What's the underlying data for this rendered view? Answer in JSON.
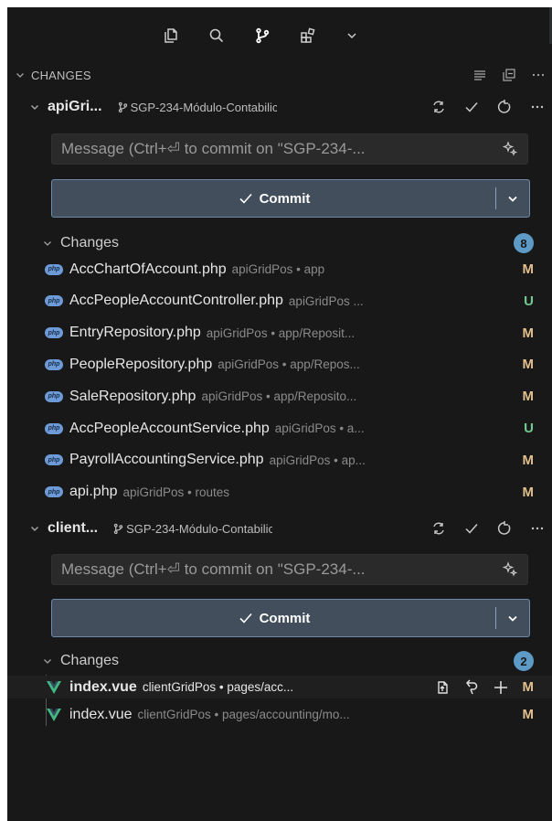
{
  "toolbar": {
    "icons": [
      "files-icon",
      "search-icon",
      "source-control-icon",
      "extensions-icon",
      "chevron-down-icon"
    ]
  },
  "section": {
    "title": "CHANGES",
    "actions": [
      "list-view-icon",
      "collapse-all-icon",
      "more-actions-icon"
    ]
  },
  "repos": [
    {
      "name": "apiGri...",
      "branch": "SGP-234-Módulo-Contabilic",
      "message_placeholder": "Message (Ctrl+⏎ to commit on \"SGP-234-...",
      "commit_label": "Commit",
      "group_label": "Changes",
      "count": "8",
      "files": [
        {
          "name": "AccChartOfAccount.php",
          "desc": "apiGridPos • app",
          "status": "M",
          "type": "php"
        },
        {
          "name": "AccPeopleAccountController.php",
          "desc": "apiGridPos ...",
          "status": "U",
          "type": "php"
        },
        {
          "name": "EntryRepository.php",
          "desc": "apiGridPos • app/Reposit...",
          "status": "M",
          "type": "php"
        },
        {
          "name": "PeopleRepository.php",
          "desc": "apiGridPos • app/Repos...",
          "status": "M",
          "type": "php"
        },
        {
          "name": "SaleRepository.php",
          "desc": "apiGridPos • app/Reposito...",
          "status": "M",
          "type": "php"
        },
        {
          "name": "AccPeopleAccountService.php",
          "desc": "apiGridPos • a...",
          "status": "U",
          "type": "php"
        },
        {
          "name": "PayrollAccountingService.php",
          "desc": "apiGridPos • ap...",
          "status": "M",
          "type": "php"
        },
        {
          "name": "api.php",
          "desc": "apiGridPos • routes",
          "status": "M",
          "type": "php"
        }
      ]
    },
    {
      "name": "client...",
      "branch": "SGP-234-Módulo-Contabilic",
      "message_placeholder": "Message (Ctrl+⏎ to commit on \"SGP-234-...",
      "commit_label": "Commit",
      "group_label": "Changes",
      "count": "2",
      "files": [
        {
          "name": "index.vue",
          "desc": "clientGridPos • pages/acc...",
          "status": "M",
          "type": "vue"
        },
        {
          "name": "index.vue",
          "desc": "clientGridPos • pages/accounting/mo...",
          "status": "M",
          "type": "vue"
        }
      ]
    }
  ],
  "php_badge_text": "php",
  "colors": {
    "background": "#181818",
    "commit_button": "#424e5c",
    "badge": "#5d9ac6",
    "modified": "#e2c08d",
    "untracked": "#73c991",
    "vue": "#41b883"
  }
}
